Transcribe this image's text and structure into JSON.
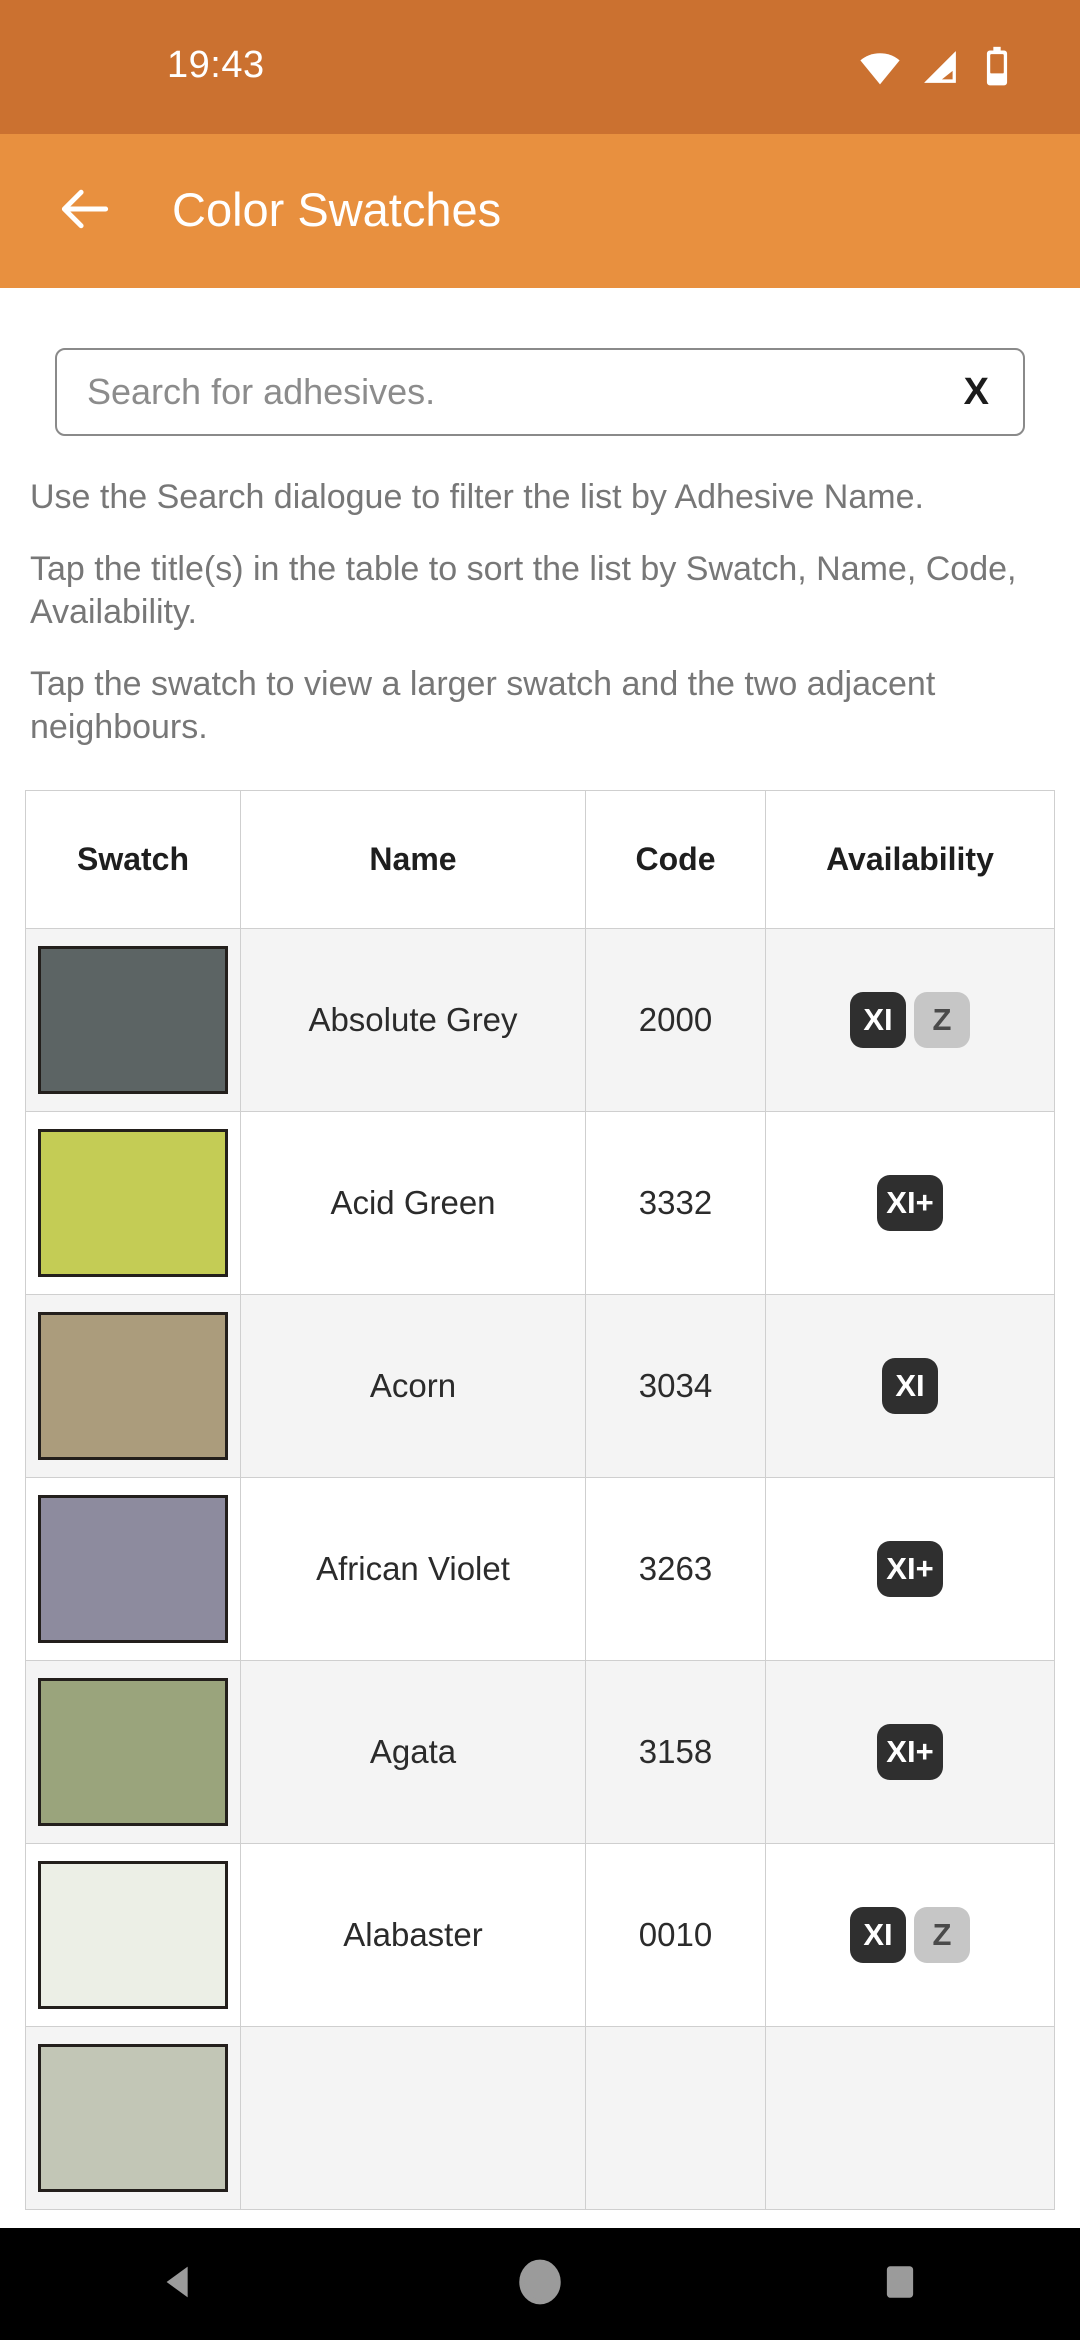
{
  "status_bar": {
    "clock": "19:43",
    "icons": [
      "wifi-icon",
      "signal-icon",
      "battery-icon"
    ],
    "background": "#cb7130"
  },
  "app_bar": {
    "back_icon": "back-arrow-icon",
    "title": "Color Swatches",
    "background": "#e8903f"
  },
  "search": {
    "placeholder": "Search for adhesives.",
    "value": "",
    "clear_label": "X"
  },
  "instructions": [
    "Use the Search dialogue to filter the list by Adhesive Name.",
    "Tap the title(s) in the table to sort the list by Swatch, Name, Code, Availability.",
    "Tap the swatch to view a larger swatch and the two adjacent neighbours."
  ],
  "table": {
    "headers": [
      "Swatch",
      "Name",
      "Code",
      "Availability"
    ],
    "rows": [
      {
        "swatch_color": "#5c6464",
        "name": "Absolute Grey",
        "code": "2000",
        "availability": [
          "XI",
          "Z"
        ]
      },
      {
        "swatch_color": "#c4cc55",
        "name": "Acid Green",
        "code": "3332",
        "availability": [
          "XI+"
        ]
      },
      {
        "swatch_color": "#ab9c7c",
        "name": "Acorn",
        "code": "3034",
        "availability": [
          "XI"
        ]
      },
      {
        "swatch_color": "#8d8b9e",
        "name": "African Violet",
        "code": "3263",
        "availability": [
          "XI+"
        ]
      },
      {
        "swatch_color": "#9aa47c",
        "name": "Agata",
        "code": "3158",
        "availability": [
          "XI+"
        ]
      },
      {
        "swatch_color": "#ecefe6",
        "name": "Alabaster",
        "code": "0010",
        "availability": [
          "XI",
          "Z"
        ]
      },
      {
        "swatch_color": "#c2c6b6",
        "name": "",
        "code": "",
        "availability": []
      }
    ]
  },
  "nav_bar": {
    "buttons": [
      "back-triangle-icon",
      "home-circle-icon",
      "recents-square-icon"
    ]
  }
}
